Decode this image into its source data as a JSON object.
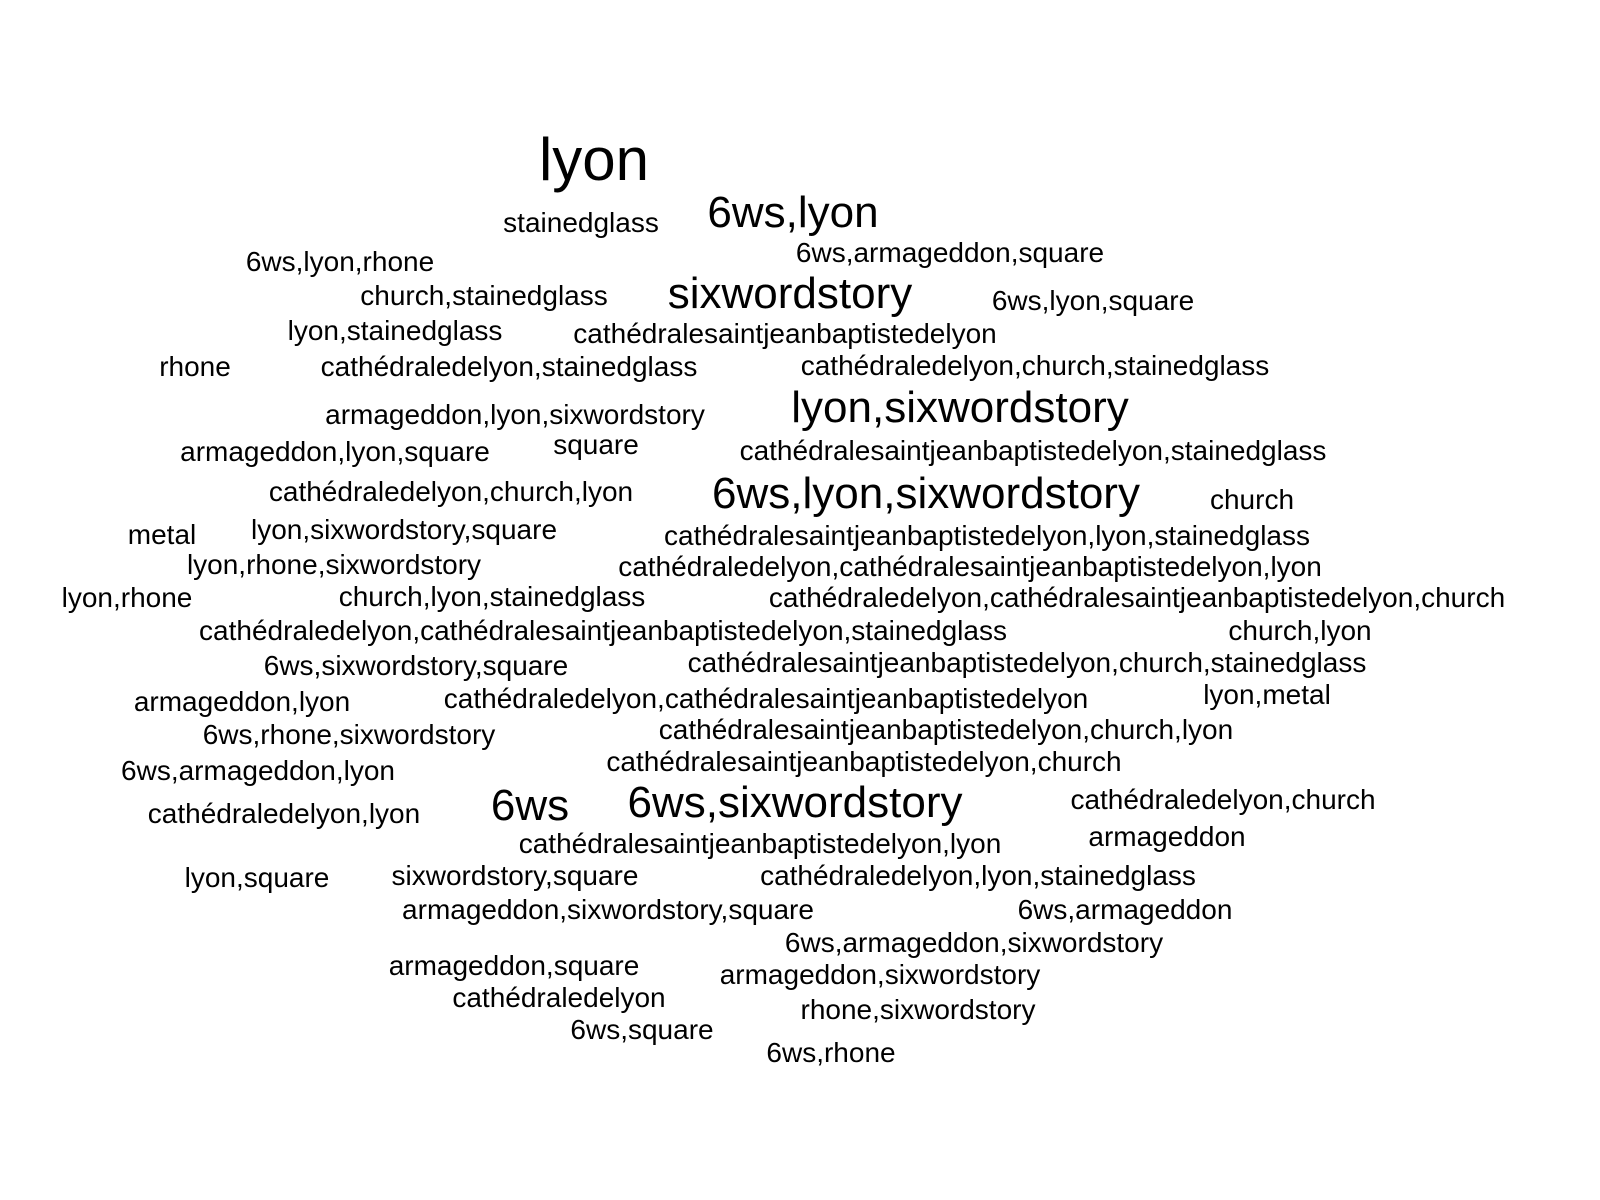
{
  "words": [
    {
      "text": "lyon"
    },
    {
      "text": "stainedglass"
    },
    {
      "text": "6ws,lyon"
    },
    {
      "text": "6ws,lyon,rhone"
    },
    {
      "text": "6ws,armageddon,square"
    },
    {
      "text": "church,stainedglass"
    },
    {
      "text": "sixwordstory"
    },
    {
      "text": "6ws,lyon,square"
    },
    {
      "text": "lyon,stainedglass"
    },
    {
      "text": "cathédralesaintjeanbaptistedelyon"
    },
    {
      "text": "rhone"
    },
    {
      "text": "cathédraledelyon,stainedglass"
    },
    {
      "text": "cathédraledelyon,church,stainedglass"
    },
    {
      "text": "armageddon,lyon,sixwordstory"
    },
    {
      "text": "lyon,sixwordstory"
    },
    {
      "text": "armageddon,lyon,square"
    },
    {
      "text": "square"
    },
    {
      "text": "cathédralesaintjeanbaptistedelyon,stainedglass"
    },
    {
      "text": "cathédraledelyon,church,lyon"
    },
    {
      "text": "6ws,lyon,sixwordstory"
    },
    {
      "text": "church"
    },
    {
      "text": "metal"
    },
    {
      "text": "lyon,sixwordstory,square"
    },
    {
      "text": "cathédralesaintjeanbaptistedelyon,lyon,stainedglass"
    },
    {
      "text": "lyon,rhone,sixwordstory"
    },
    {
      "text": "cathédraledelyon,cathédralesaintjeanbaptistedelyon,lyon"
    },
    {
      "text": "lyon,rhone"
    },
    {
      "text": "church,lyon,stainedglass"
    },
    {
      "text": "cathédraledelyon,cathédralesaintjeanbaptistedelyon,church"
    },
    {
      "text": "cathédraledelyon,cathédralesaintjeanbaptistedelyon,stainedglass"
    },
    {
      "text": "church,lyon"
    },
    {
      "text": "6ws,sixwordstory,square"
    },
    {
      "text": "cathédralesaintjeanbaptistedelyon,church,stainedglass"
    },
    {
      "text": "armageddon,lyon"
    },
    {
      "text": "cathédraledelyon,cathédralesaintjeanbaptistedelyon"
    },
    {
      "text": "lyon,metal"
    },
    {
      "text": "6ws,rhone,sixwordstory"
    },
    {
      "text": "cathédralesaintjeanbaptistedelyon,church,lyon"
    },
    {
      "text": "6ws,armageddon,lyon"
    },
    {
      "text": "cathédralesaintjeanbaptistedelyon,church"
    },
    {
      "text": "cathédraledelyon,lyon"
    },
    {
      "text": "6ws"
    },
    {
      "text": "6ws,sixwordstory"
    },
    {
      "text": "cathédraledelyon,church"
    },
    {
      "text": "cathédralesaintjeanbaptistedelyon,lyon"
    },
    {
      "text": "armageddon"
    },
    {
      "text": "lyon,square"
    },
    {
      "text": "sixwordstory,square"
    },
    {
      "text": "cathédraledelyon,lyon,stainedglass"
    },
    {
      "text": "armageddon,sixwordstory,square"
    },
    {
      "text": "6ws,armageddon"
    },
    {
      "text": "6ws,armageddon,sixwordstory"
    },
    {
      "text": "armageddon,square"
    },
    {
      "text": "armageddon,sixwordstory"
    },
    {
      "text": "cathédraledelyon"
    },
    {
      "text": "rhone,sixwordstory"
    },
    {
      "text": "6ws,square"
    },
    {
      "text": "6ws,rhone"
    }
  ]
}
